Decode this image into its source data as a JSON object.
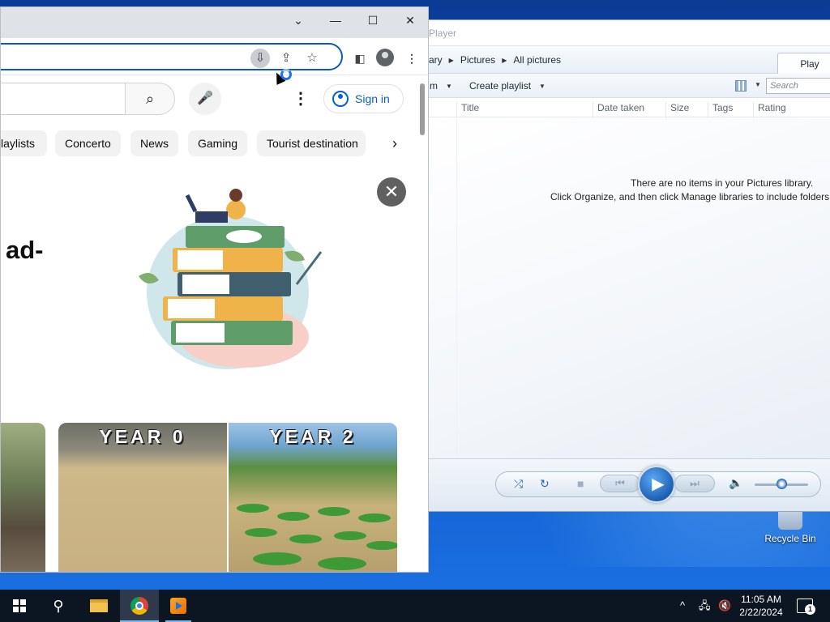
{
  "desktop": {
    "recycle_bin_label": "Recycle Bin"
  },
  "media_player": {
    "title": "Player",
    "breadcrumb": [
      "ary",
      "Pictures",
      "All pictures"
    ],
    "play_tab": "Play",
    "toolbar": {
      "organize_partial": "m",
      "create_playlist": "Create playlist"
    },
    "search_placeholder": "Search",
    "columns": [
      "Title",
      "Date taken",
      "Size",
      "Tags",
      "Rating"
    ],
    "empty_line1": "There are no items in your Pictures library.",
    "empty_line2": "Click Organize, and then click Manage libraries to include folders i",
    "volume_level": 0.5
  },
  "chrome": {
    "window_buttons": {
      "dropdown": "⌄",
      "minimize": "—",
      "maximize": "☐",
      "close": "✕"
    },
    "omnibox_icons": [
      "install-icon",
      "share-icon",
      "bookmark-star-icon"
    ],
    "youtube": {
      "signin_label": "Sign in",
      "chips": [
        "laylists",
        "Concerto",
        "News",
        "Gaming",
        "Tourist destination"
      ],
      "ad_text": "ad-",
      "thumbnail": {
        "left_label": "YEAR 0",
        "right_label": "YEAR 2"
      }
    }
  },
  "taskbar": {
    "clock_time": "11:05 AM",
    "clock_date": "2/22/2024",
    "notification_count": "1"
  }
}
